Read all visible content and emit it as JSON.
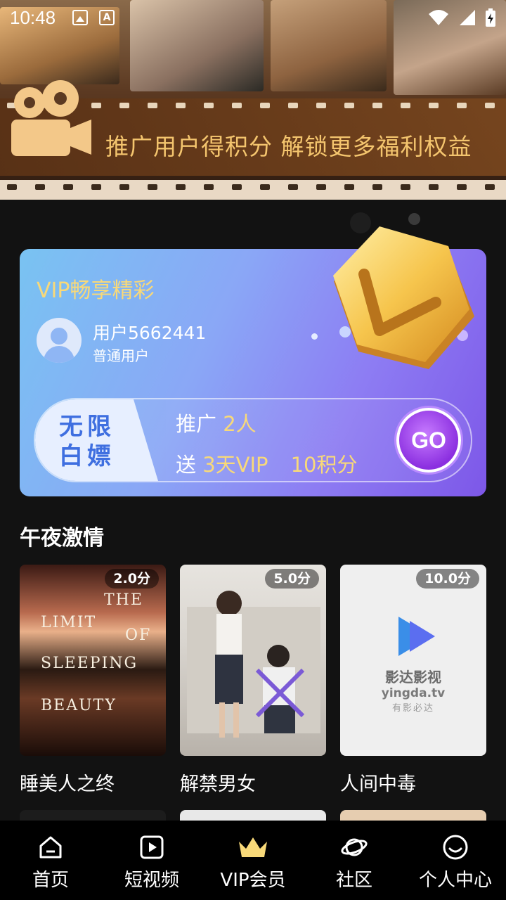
{
  "status_bar": {
    "time": "10:48"
  },
  "banner": {
    "text": "推广用户得积分 解锁更多福利权益"
  },
  "vip_card": {
    "title": "VIP畅享精彩",
    "user_name": "用户5662441",
    "user_level": "普通用户",
    "promo_left": "无限白嫖",
    "promo_line1_prefix": "推广 ",
    "promo_line1_count": "2人",
    "promo_line2_prefix": "送 ",
    "promo_line2_vip": "3天VIP",
    "promo_line2_points": "10积分",
    "go_label": "GO"
  },
  "section": {
    "title": "午夜激情",
    "movies": [
      {
        "title": "睡美人之终",
        "score": "2.0分"
      },
      {
        "title": "解禁男女",
        "score": "5.0分"
      },
      {
        "title": "人间中毒",
        "score": "10.0分"
      }
    ]
  },
  "poster_text": {
    "p1_lines": [
      "THE",
      "LIMIT",
      "OF",
      "SLEEPING",
      "BEAUTY"
    ],
    "p3_brand": "影达影视",
    "p3_domain": "yingda.tv",
    "p3_slogan": "有影必达"
  },
  "bottom_nav": {
    "items": [
      {
        "label": "首页",
        "icon": "home-icon"
      },
      {
        "label": "短视频",
        "icon": "play-icon"
      },
      {
        "label": "VIP会员",
        "icon": "crown-icon"
      },
      {
        "label": "社区",
        "icon": "planet-icon"
      },
      {
        "label": "个人中心",
        "icon": "smile-icon"
      }
    ]
  },
  "colors": {
    "accent_gold": "#f8d979",
    "banner_text": "#f4c56e",
    "card_gradient_start": "#79c3f2",
    "card_gradient_end": "#7d57e8"
  }
}
